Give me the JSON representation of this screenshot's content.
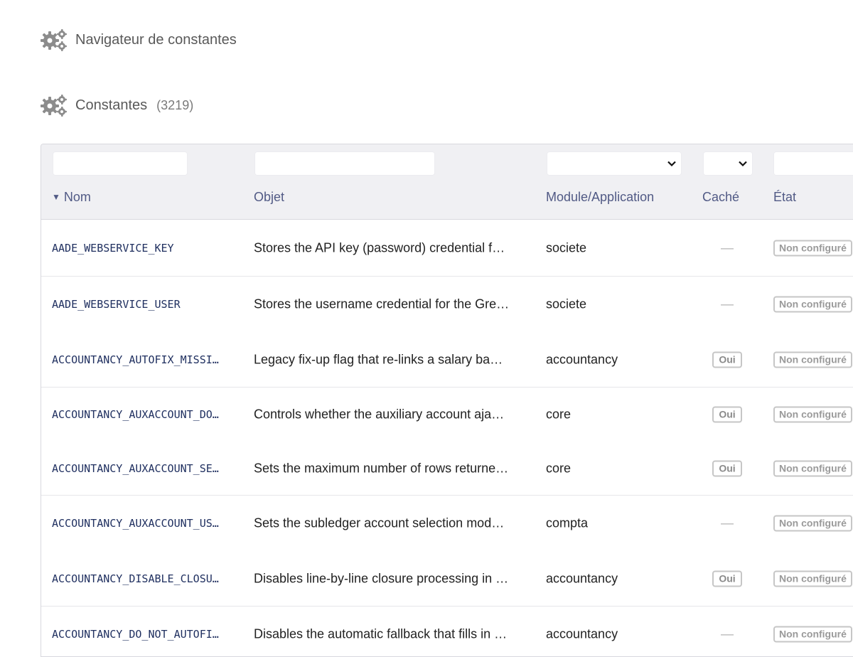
{
  "header": {
    "title": "Navigateur de constantes",
    "section_title": "Constantes",
    "count": "(3219)",
    "icon": "gears-icon"
  },
  "table": {
    "columns": {
      "name": "Nom",
      "object": "Objet",
      "module": "Module/Application",
      "cache": "Caché",
      "state": "État"
    },
    "sort_indicator": "▼",
    "rows": [
      {
        "name": "AADE_WEBSERVICE_KEY",
        "object": "Stores the API key (password) credential f…",
        "module": "societe",
        "cache": "—",
        "state": "Non configuré"
      },
      {
        "name": "AADE_WEBSERVICE_USER",
        "object": "Stores the username credential for the Gre…",
        "module": "societe",
        "cache": "—",
        "state": "Non configuré"
      },
      {
        "name": "ACCOUNTANCY_AUTOFIX_MISSI…",
        "object": "Legacy fix-up flag that re-links a salary ba…",
        "module": "accountancy",
        "cache": "Oui",
        "state": "Non configuré"
      },
      {
        "name": "ACCOUNTANCY_AUXACCOUNT_DO…",
        "object": "Controls whether the auxiliary account aja…",
        "module": "core",
        "cache": "Oui",
        "state": "Non configuré"
      },
      {
        "name": "ACCOUNTANCY_AUXACCOUNT_SE…",
        "object": "Sets the maximum number of rows returne…",
        "module": "core",
        "cache": "Oui",
        "state": "Non configuré"
      },
      {
        "name": "ACCOUNTANCY_AUXACCOUNT_US…",
        "object": "Sets the subledger account selection mod…",
        "module": "compta",
        "cache": "—",
        "state": "Non configuré"
      },
      {
        "name": "ACCOUNTANCY_DISABLE_CLOSU…",
        "object": "Disables line-by-line closure processing in …",
        "module": "accountancy",
        "cache": "Oui",
        "state": "Non configuré"
      },
      {
        "name": "ACCOUNTANCY_DO_NOT_AUTOFI…",
        "object": "Disables the automatic fallback that fills in …",
        "module": "accountancy",
        "cache": "—",
        "state": "Non configuré"
      }
    ]
  }
}
